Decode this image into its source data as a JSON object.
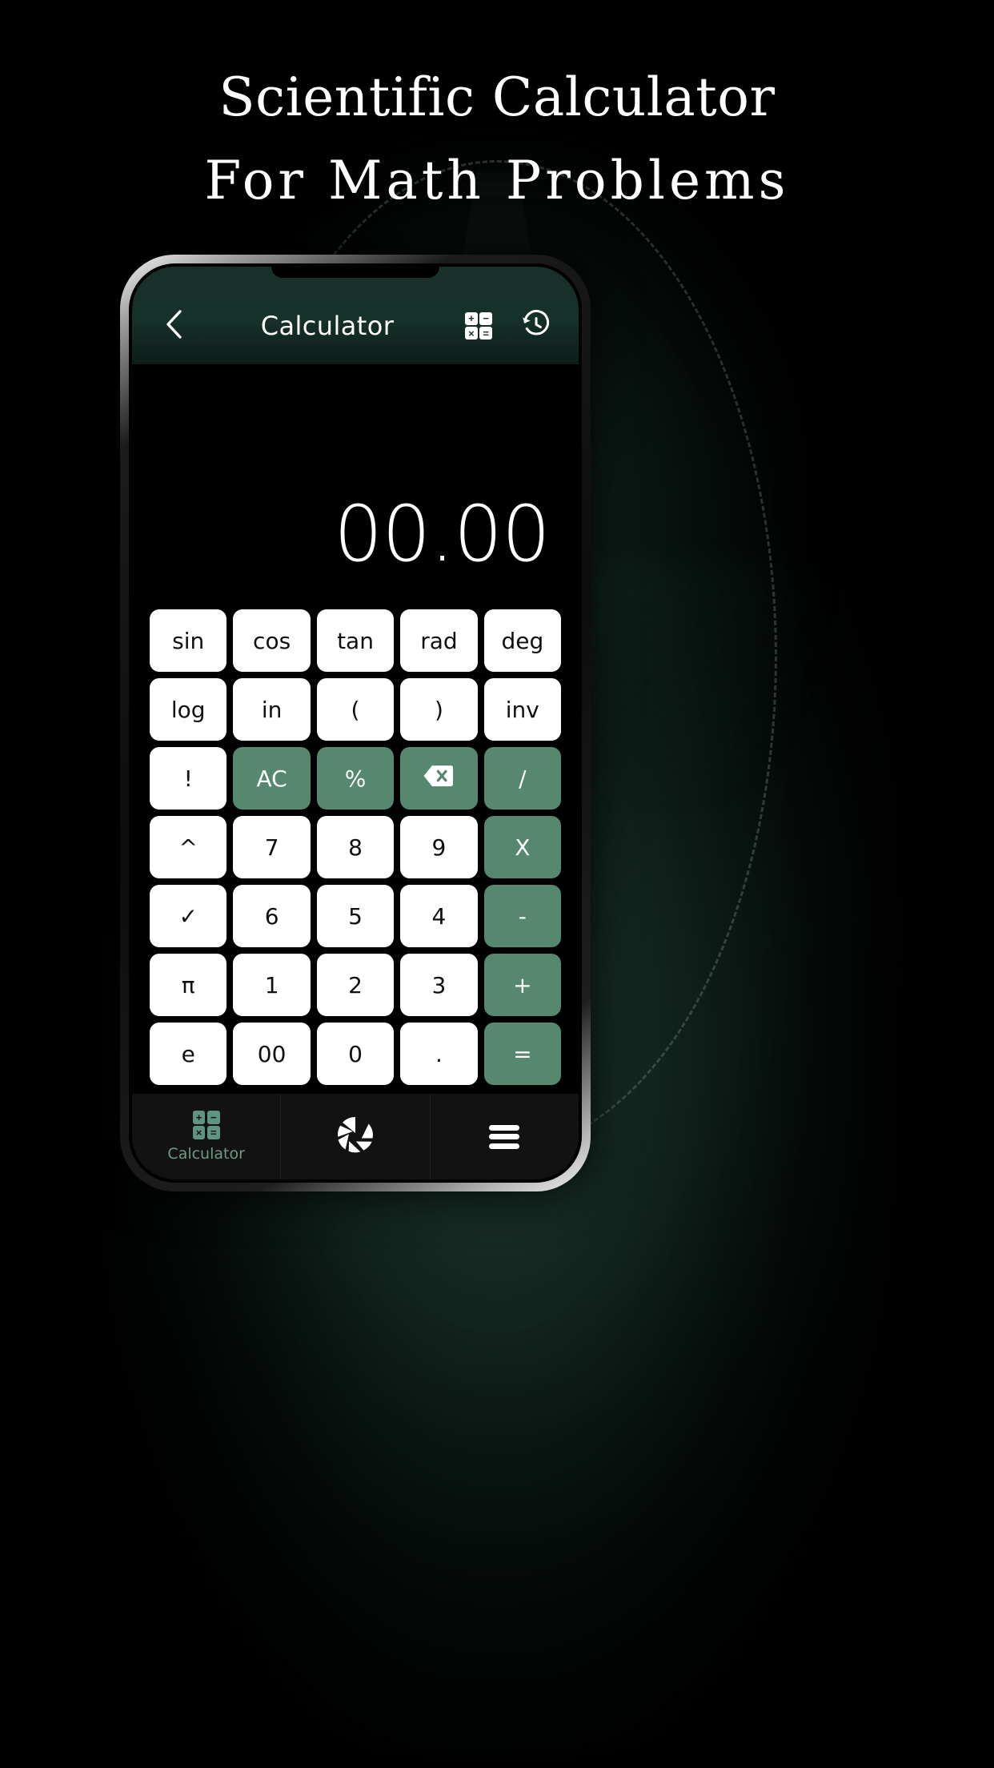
{
  "headline": {
    "line1": "Scientific Calculator",
    "line2": "For Math Problems"
  },
  "theme": {
    "accent": "#55886f",
    "nav_accent": "#6d9c86",
    "header_bg": "#16302a",
    "screen_bg": "#000000",
    "key_bg": "#ffffff",
    "key_text": "#101010"
  },
  "app": {
    "header": {
      "back_icon": "chevron-left-icon",
      "title": "Calculator",
      "grid_icon": "calculator-grid-icon",
      "grid_icon_symbols": [
        "+",
        "−",
        "×",
        "="
      ],
      "history_icon": "history-clock-icon"
    },
    "display": {
      "value": "00.00"
    },
    "keypad": {
      "rows": [
        [
          {
            "label": "sin",
            "style": "plain",
            "name": "key-sin"
          },
          {
            "label": "cos",
            "style": "plain",
            "name": "key-cos"
          },
          {
            "label": "tan",
            "style": "plain",
            "name": "key-tan"
          },
          {
            "label": "rad",
            "style": "plain",
            "name": "key-rad"
          },
          {
            "label": "deg",
            "style": "plain",
            "name": "key-deg"
          }
        ],
        [
          {
            "label": "log",
            "style": "plain",
            "name": "key-log"
          },
          {
            "label": "in",
            "style": "plain",
            "name": "key-in"
          },
          {
            "label": "(",
            "style": "plain",
            "name": "key-open-paren"
          },
          {
            "label": ")",
            "style": "plain",
            "name": "key-close-paren"
          },
          {
            "label": "inv",
            "style": "plain",
            "name": "key-inv"
          }
        ],
        [
          {
            "label": "!",
            "style": "plain",
            "name": "key-factorial"
          },
          {
            "label": "AC",
            "style": "accent",
            "name": "key-all-clear"
          },
          {
            "label": "%",
            "style": "accent",
            "name": "key-percent"
          },
          {
            "label": "⌫",
            "style": "accent",
            "name": "key-backspace",
            "icon": "backspace-icon"
          },
          {
            "label": "/",
            "style": "accent",
            "name": "key-divide"
          }
        ],
        [
          {
            "label": "^",
            "style": "plain",
            "name": "key-power"
          },
          {
            "label": "7",
            "style": "plain",
            "name": "key-7"
          },
          {
            "label": "8",
            "style": "plain",
            "name": "key-8"
          },
          {
            "label": "9",
            "style": "plain",
            "name": "key-9"
          },
          {
            "label": "X",
            "style": "accent",
            "name": "key-multiply"
          }
        ],
        [
          {
            "label": "✓",
            "style": "plain",
            "name": "key-square-root"
          },
          {
            "label": "6",
            "style": "plain",
            "name": "key-6"
          },
          {
            "label": "5",
            "style": "plain",
            "name": "key-5"
          },
          {
            "label": "4",
            "style": "plain",
            "name": "key-4"
          },
          {
            "label": "-",
            "style": "accent",
            "name": "key-minus"
          }
        ],
        [
          {
            "label": "π",
            "style": "plain",
            "name": "key-pi"
          },
          {
            "label": "1",
            "style": "plain",
            "name": "key-1"
          },
          {
            "label": "2",
            "style": "plain",
            "name": "key-2"
          },
          {
            "label": "3",
            "style": "plain",
            "name": "key-3"
          },
          {
            "label": "+",
            "style": "accent",
            "name": "key-plus"
          }
        ],
        [
          {
            "label": "e",
            "style": "plain",
            "name": "key-e"
          },
          {
            "label": "00",
            "style": "plain",
            "name": "key-double-zero"
          },
          {
            "label": "0",
            "style": "plain",
            "name": "key-0"
          },
          {
            "label": ".",
            "style": "plain",
            "name": "key-decimal"
          },
          {
            "label": "=",
            "style": "accent",
            "name": "key-equals"
          }
        ]
      ]
    },
    "bottom_nav": [
      {
        "label": "Calculator",
        "icon": "calculator-icon",
        "active": true,
        "name": "nav-calculator"
      },
      {
        "label": "",
        "icon": "camera-aperture-icon",
        "active": false,
        "name": "nav-camera"
      },
      {
        "label": "",
        "icon": "menu-hamburger-icon",
        "active": false,
        "name": "nav-menu"
      }
    ]
  }
}
